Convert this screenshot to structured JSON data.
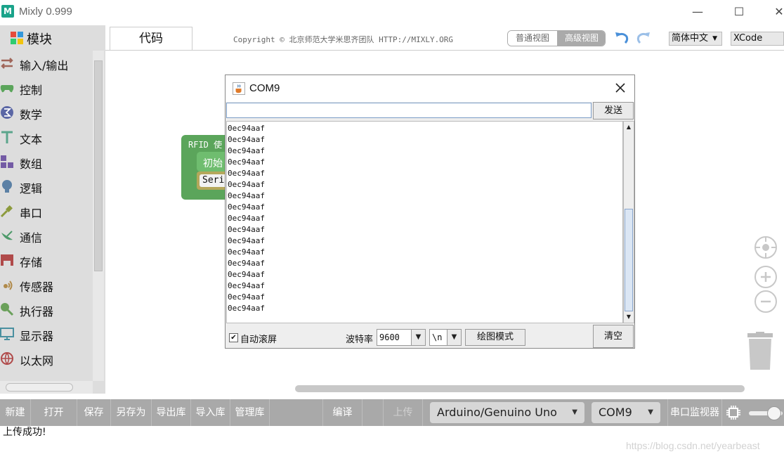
{
  "window": {
    "title": "Mixly 0.999",
    "logo_text": "M",
    "minimize_glyph": "—",
    "maximize_glyph": "☐",
    "close_glyph": "✕"
  },
  "sidebar": {
    "title": "模块",
    "items": [
      {
        "label": "输入/输出",
        "icon": "io-arrows-icon",
        "color": "#a0665a"
      },
      {
        "label": "控制",
        "icon": "gamepad-icon",
        "color": "#5ba55b"
      },
      {
        "label": "数学",
        "icon": "sigma-icon",
        "color": "#5b67a5"
      },
      {
        "label": "文本",
        "icon": "text-t-icon",
        "color": "#5ba58c"
      },
      {
        "label": "数组",
        "icon": "blocks-array-icon",
        "color": "#745ba5"
      },
      {
        "label": "逻辑",
        "icon": "lightbulb-icon",
        "color": "#5b80a5"
      },
      {
        "label": "串口",
        "icon": "usb-plug-icon",
        "color": "#8c9a3c"
      },
      {
        "label": "通信",
        "icon": "satellite-icon",
        "color": "#4d9a6a"
      },
      {
        "label": "存储",
        "icon": "storage-icon",
        "color": "#b04a4a"
      },
      {
        "label": "传感器",
        "icon": "sensor-icon",
        "color": "#b08a4a"
      },
      {
        "label": "执行器",
        "icon": "actuator-icon",
        "color": "#6aa05a"
      },
      {
        "label": "显示器",
        "icon": "monitor-icon",
        "color": "#4a90a0"
      },
      {
        "label": "以太网",
        "icon": "globe-icon",
        "color": "#b04a4a"
      }
    ]
  },
  "topbar": {
    "code_tab": "代码",
    "copyright": "Copyright © 北京师范大学米思齐团队 HTTP://MIXLY.ORG",
    "view_normal": "普通视图",
    "view_advanced": "高级视图",
    "language": "简体中文",
    "editor": "XCode",
    "accent": "#4a90d9"
  },
  "workspace": {
    "block_rfid": "RFID 使",
    "block_init": "初始",
    "block_serial": "Seri"
  },
  "dialog": {
    "title": "COM9",
    "input_value": "",
    "send": "发送",
    "lines": [
      "0ec94aaf",
      "0ec94aaf",
      "0ec94aaf",
      "0ec94aaf",
      "0ec94aaf",
      "0ec94aaf",
      "0ec94aaf",
      "0ec94aaf",
      "0ec94aaf",
      "0ec94aaf",
      "0ec94aaf",
      "0ec94aaf",
      "0ec94aaf",
      "0ec94aaf",
      "0ec94aaf",
      "0ec94aaf",
      "0ec94aaf"
    ],
    "autoscroll_label": "自动滚屏",
    "autoscroll_check": "✔",
    "baud_label": "波特率",
    "baud_value": "9600",
    "eol_value": "\\n",
    "plot_button": "绘图模式",
    "clear_button": "清空"
  },
  "bottombar": {
    "new": "新建",
    "open": "打开",
    "save": "保存",
    "save_as": "另存为",
    "export_lib": "导出库",
    "import_lib": "导入库",
    "manage_lib": "管理库",
    "compile": "编译",
    "upload": "上传",
    "board": "Arduino/Genuino Uno",
    "port": "COM9",
    "serial_monitor": "串口监视器"
  },
  "status": {
    "message": "上传成功!",
    "watermark": "https://blog.csdn.net/yearbeast"
  }
}
